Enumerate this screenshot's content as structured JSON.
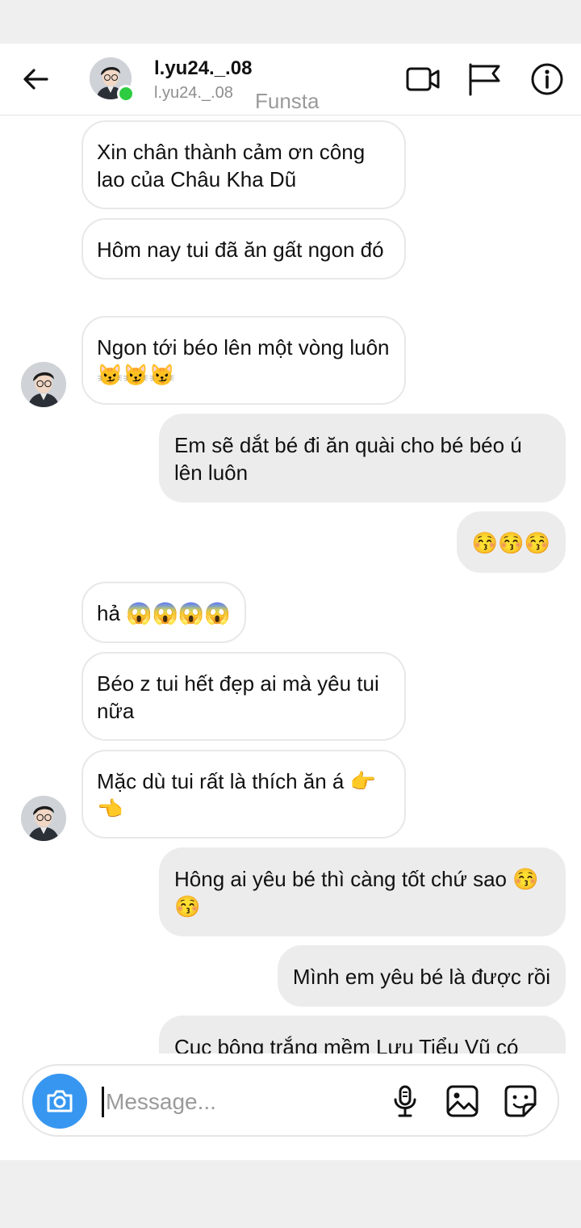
{
  "header": {
    "back_icon": "arrow-left-icon",
    "name": "l.yu24._.08",
    "handle": "l.yu24._.08",
    "tag": "Funsta",
    "online_color": "#2ecc40",
    "icons": [
      "video-call-icon",
      "flag-icon",
      "info-icon"
    ]
  },
  "messages": [
    {
      "from": "them",
      "text": "Xin chân thành cảm ơn công lao của Châu Kha Dũ"
    },
    {
      "from": "them",
      "text": "Hôm nay tui đã ăn gất ngon đó"
    },
    {
      "from": "them",
      "text": "Ngon tới béo lên một vòng luôn 😼😼😼"
    },
    {
      "from": "me",
      "text": "Em sẽ dắt bé đi ăn quài cho bé béo ú lên luôn"
    },
    {
      "from": "me",
      "text": "😚😚😚"
    },
    {
      "from": "them",
      "text": "hả 😱😱😱😱"
    },
    {
      "from": "them",
      "text": "Béo z tui hết đẹp ai mà yêu tui nữa"
    },
    {
      "from": "them",
      "text": "Mặc dù tui rất là thích ăn á 👉👈"
    },
    {
      "from": "me",
      "text": "Hông ai yêu bé thì càng tốt chứ sao 😚😚"
    },
    {
      "from": "me",
      "text": "Mình em yêu bé là được rồi"
    },
    {
      "from": "me",
      "text": "Cục bông trắng mềm Lưu Tiểu Vũ có"
    }
  ],
  "composer": {
    "placeholder": "Message...",
    "camera_icon": "camera-icon",
    "icons": [
      "microphone-icon",
      "gallery-icon",
      "sticker-icon"
    ],
    "accent": "#3797f0"
  }
}
